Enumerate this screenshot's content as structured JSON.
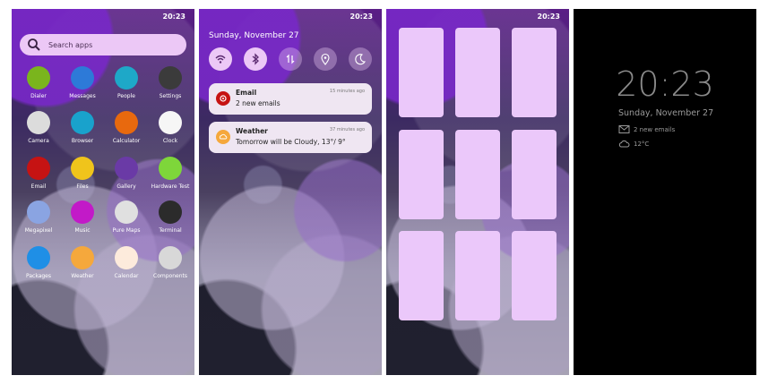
{
  "status_time": "20:23",
  "launcher": {
    "search_placeholder": "Search apps",
    "apps": [
      {
        "label": "Dialer",
        "color": "#7ab51d"
      },
      {
        "label": "Messages",
        "color": "#2d7ad8"
      },
      {
        "label": "People",
        "color": "#1ea8c8"
      },
      {
        "label": "Settings",
        "color": "#3b3b3b"
      },
      {
        "label": "Camera",
        "color": "#dcdcdc"
      },
      {
        "label": "Browser",
        "color": "#19a2cc"
      },
      {
        "label": "Calculator",
        "color": "#e8690e"
      },
      {
        "label": "Clock",
        "color": "#f6f6f6"
      },
      {
        "label": "Email",
        "color": "#c61313"
      },
      {
        "label": "Files",
        "color": "#f0c41b"
      },
      {
        "label": "Gallery",
        "color": "#6a3aa6"
      },
      {
        "label": "Hardware Test",
        "color": "#7ed63a"
      },
      {
        "label": "Megapixel",
        "color": "#8aa4e2"
      },
      {
        "label": "Music",
        "color": "#c21ac8"
      },
      {
        "label": "Pure Maps",
        "color": "#e0e0e0"
      },
      {
        "label": "Terminal",
        "color": "#2b2b2b"
      },
      {
        "label": "Packages",
        "color": "#1f8fe6"
      },
      {
        "label": "Weather",
        "color": "#f5a83c"
      },
      {
        "label": "Calendar",
        "color": "#fdebdc"
      },
      {
        "label": "Components",
        "color": "#d8d8d8"
      }
    ]
  },
  "notifications_panel": {
    "date": "Sunday, November 27",
    "quick_settings": [
      "wifi-icon",
      "bluetooth-icon",
      "mobile-data-icon",
      "location-icon",
      "night-mode-icon"
    ],
    "notifications": [
      {
        "title": "Email",
        "time": "15 minutes ago",
        "body": "2 new emails",
        "icon": "email-app-icon",
        "icon_color": "#c61313"
      },
      {
        "title": "Weather",
        "time": "37 minutes ago",
        "body": "Tomorrow will be Cloudy, 13°/ 9°",
        "icon": "weather-app-icon",
        "icon_color": "#f5a83c"
      }
    ]
  },
  "task_switcher": {
    "cards": 9
  },
  "lockscreen": {
    "time": "20:23",
    "date": "Sunday, November 27",
    "emails": "2 new emails",
    "temperature": "12°C"
  }
}
